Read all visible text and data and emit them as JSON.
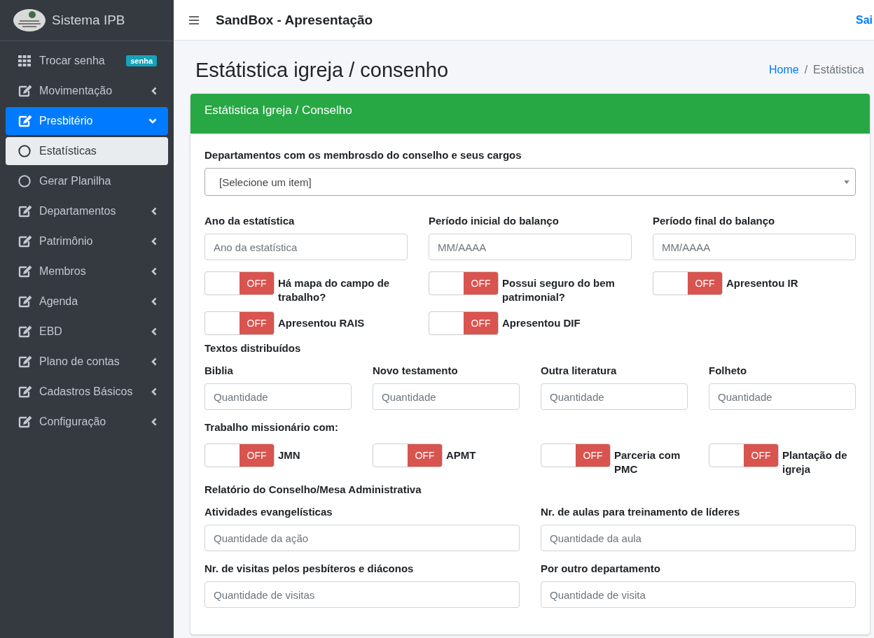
{
  "sidebar": {
    "brand": "Sistema IPB",
    "items": [
      {
        "label": "Trocar senha",
        "badge": "senha",
        "selected": false
      },
      {
        "label": "Movimentação",
        "expanded": false,
        "selected": false
      },
      {
        "label": "Presbitério",
        "expanded": true,
        "selected": true,
        "children": [
          {
            "label": "Estatísticas",
            "selected": true
          },
          {
            "label": "Gerar Planilha",
            "selected": false
          }
        ]
      },
      {
        "label": "Departamentos",
        "expanded": false,
        "selected": false
      },
      {
        "label": "Patrimônio",
        "expanded": false,
        "selected": false
      },
      {
        "label": "Membros",
        "expanded": false,
        "selected": false
      },
      {
        "label": "Agenda",
        "expanded": false,
        "selected": false
      },
      {
        "label": "EBD",
        "expanded": false,
        "selected": false
      },
      {
        "label": "Plano de contas",
        "expanded": false,
        "selected": false
      },
      {
        "label": "Cadastros Básicos",
        "expanded": false,
        "selected": false
      },
      {
        "label": "Configuração",
        "expanded": false,
        "selected": false
      }
    ]
  },
  "navbar": {
    "title": "SandBox - Apresentação",
    "link": "Sai"
  },
  "page": {
    "title": "Estátistica igreja / consenho",
    "breadcrumb": [
      {
        "kind": "link",
        "text": "Home"
      },
      {
        "kind": "separator",
        "text": "/"
      },
      {
        "kind": "current",
        "text": "Estátistica"
      }
    ]
  },
  "card": {
    "title": "Estátistica Igreja / Conselho",
    "form": [
      {
        "kind": "select",
        "label": "Departamentos com os membrosdo do conselho e seus cargos",
        "value": "[Selecione um item]"
      },
      {
        "kind": "fields",
        "fields": [
          {
            "label": "Ano da estatística",
            "placeholder": "Ano da estatística"
          },
          {
            "label": "Período inicial do balanço",
            "placeholder": "MM/AAAA"
          },
          {
            "label": "Período final do balanço",
            "placeholder": "MM/AAAA"
          }
        ]
      },
      {
        "kind": "toggles",
        "rows": [
          [
            {
              "label": "Há mapa do campo de trabalho?",
              "on": false,
              "state_text": "OFF"
            },
            {
              "label": "Possui seguro do bem patrimonial?",
              "on": false,
              "state_text": "OFF"
            },
            {
              "label": "Apresentou IR",
              "on": false,
              "state_text": "OFF"
            }
          ],
          [
            {
              "label": "Apresentou RAIS",
              "on": false,
              "state_text": "OFF"
            },
            {
              "label": "Apresentou DIF",
              "on": false,
              "state_text": "OFF"
            }
          ]
        ]
      },
      {
        "kind": "heading",
        "text": "Textos distribuídos"
      },
      {
        "kind": "fields",
        "fields": [
          {
            "label": "Biblia",
            "placeholder": "Quantidade"
          },
          {
            "label": "Novo testamento",
            "placeholder": "Quantidade"
          },
          {
            "label": "Outra literatura",
            "placeholder": "Quantidade"
          },
          {
            "label": "Folheto",
            "placeholder": "Quantidade"
          }
        ]
      },
      {
        "kind": "heading",
        "text": "Trabalho missionário com:"
      },
      {
        "kind": "toggles",
        "rows": [
          [
            {
              "label": "JMN",
              "on": false,
              "state_text": "OFF"
            },
            {
              "label": "APMT",
              "on": false,
              "state_text": "OFF"
            },
            {
              "label": "Parceria com PMC",
              "on": false,
              "state_text": "OFF"
            },
            {
              "label": "Plantação de igreja",
              "on": false,
              "state_text": "OFF"
            }
          ]
        ]
      },
      {
        "kind": "heading",
        "text": "Relatório do Conselho/Mesa Administrativa"
      },
      {
        "kind": "fields",
        "fields": [
          {
            "label": "Atividades evangelísticas",
            "placeholder": "Quantidade da ação"
          },
          {
            "label": "Nr. de aulas para treinamento de líderes",
            "placeholder": "Quantidade da aula"
          }
        ]
      },
      {
        "kind": "fields",
        "fields": [
          {
            "label": "Nr. de visitas pelos pesbíteros e diáconos",
            "placeholder": "Quantidade de visitas"
          },
          {
            "label": "Por outro departamento",
            "placeholder": "Quantidade de visita"
          }
        ]
      }
    ]
  }
}
